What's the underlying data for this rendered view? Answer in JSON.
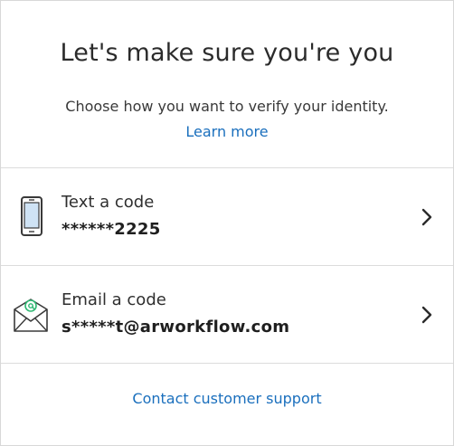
{
  "header": {
    "title": "Let's make sure you're you",
    "subtitle": "Choose how you want to verify your identity.",
    "learn_more": "Learn more"
  },
  "options": [
    {
      "label": "Text a code",
      "value": "******2225",
      "icon": "phone-icon"
    },
    {
      "label": "Email a code",
      "value": "s*****t@arworkflow.com",
      "icon": "envelope-icon"
    }
  ],
  "footer": {
    "support_link": "Contact customer support"
  },
  "colors": {
    "link": "#1a6fbd",
    "divider": "#dcdcdc",
    "icon_accent": "#2eb872",
    "phone_screen": "#cfe3f5"
  }
}
